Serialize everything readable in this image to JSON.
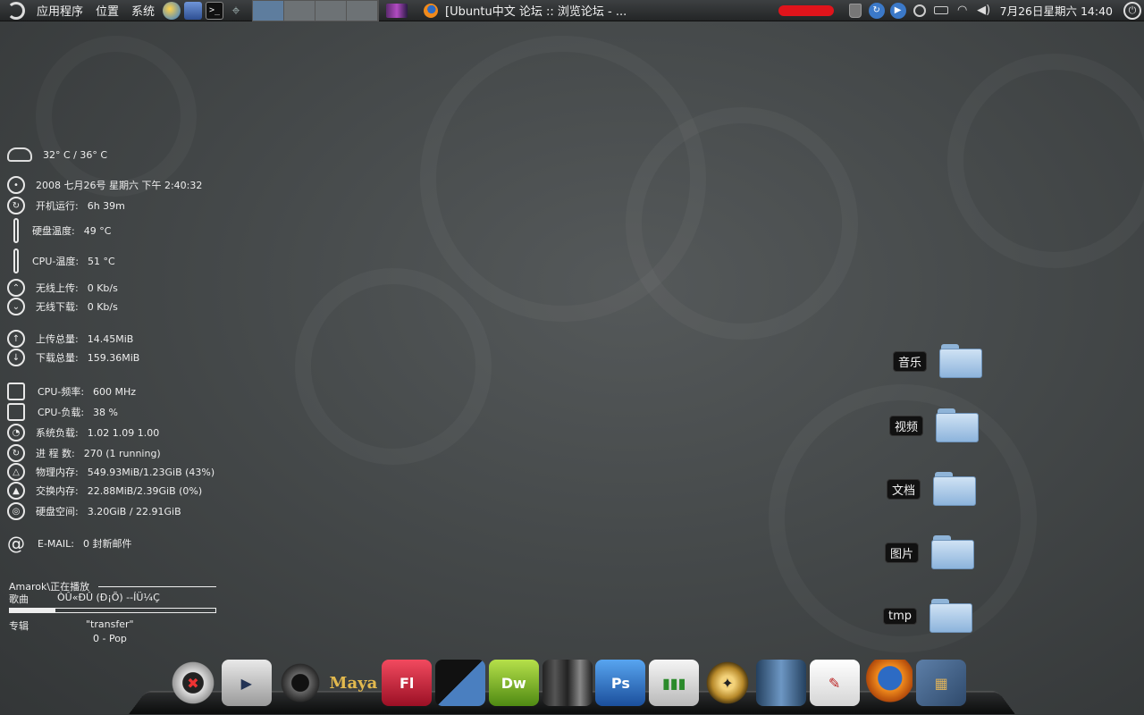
{
  "top_panel": {
    "menus": [
      "应用程序",
      "位置",
      "系统"
    ],
    "task_title": "[Ubuntu中文 论坛 :: 浏览论坛 - ...",
    "clock": "7月26日星期六 14:40",
    "launcher_icons": [
      "swirl-icon",
      "notes-icon",
      "terminal-icon",
      "crosshair-icon"
    ],
    "workspace_count": 4,
    "active_workspace": 1,
    "tray_icons": [
      "trash-icon",
      "network-share-icon",
      "play-icon",
      "search-icon",
      "keyboard-icon",
      "wifi-icon",
      "volume-icon"
    ]
  },
  "conky": {
    "weather": "32° C / 36° C",
    "datetime": "2008 七月26号 星期六 下午  2:40:32",
    "rows": [
      {
        "label": "开机运行:",
        "value": "6h 39m"
      },
      {
        "label": "硬盘温度:",
        "value": "49 °C"
      },
      {
        "label": "CPU-温度:",
        "value": "51 °C"
      },
      {
        "label": "无线上传:",
        "value": "0 Kb/s"
      },
      {
        "label": "无线下载:",
        "value": "0 Kb/s"
      },
      {
        "label": "上传总量:",
        "value": "14.45MiB"
      },
      {
        "label": "下载总量:",
        "value": "159.36MiB"
      },
      {
        "label": "CPU-频率:",
        "value": "600 MHz"
      },
      {
        "label": "CPU-负载:",
        "value": "38 %"
      },
      {
        "label": "系统负载:",
        "value": "1.02 1.09 1.00"
      },
      {
        "label": "进 程 数:",
        "value": "270 (1 running)"
      },
      {
        "label": "物理内存:",
        "value": "549.93MiB/1.23GiB (43%)"
      },
      {
        "label": "交换内存:",
        "value": "22.88MiB/2.39GiB (0%)"
      },
      {
        "label": "硬盘空间:",
        "value": "3.20GiB / 22.91GiB"
      },
      {
        "label": "E-MAIL:",
        "value": "0 封新邮件"
      }
    ],
    "amarok": {
      "header": "Amarok\\正在播放",
      "song_label": "歌曲",
      "song_value": "ÒÛ«ÐÛ (Ð¡Õ) --ÍÜ¼Ç",
      "progress": 0.22,
      "album_label": "专辑",
      "album_value": "\"transfer\"",
      "track_line": "0 - Pop"
    }
  },
  "desktop_items": [
    "音乐",
    "视频",
    "文档",
    "图片",
    "tmp"
  ],
  "dock": {
    "items": [
      {
        "name": "crossover-icon",
        "glyph": "✖"
      },
      {
        "name": "video-player-icon",
        "glyph": "▶"
      },
      {
        "name": "speaker-icon",
        "glyph": ""
      },
      {
        "name": "maya-icon",
        "glyph": "Maya"
      },
      {
        "name": "flash-icon",
        "glyph": "Fl"
      },
      {
        "name": "clapperboard-icon",
        "glyph": ""
      },
      {
        "name": "dreamweaver-icon",
        "glyph": "Dw"
      },
      {
        "name": "pens-icon",
        "glyph": ""
      },
      {
        "name": "photoshop-icon",
        "glyph": "Ps"
      },
      {
        "name": "chart-icon",
        "glyph": "▮▮▮"
      },
      {
        "name": "compass-icon",
        "glyph": "✦"
      },
      {
        "name": "bar-graph-icon",
        "glyph": ""
      },
      {
        "name": "notes-editor-icon",
        "glyph": "✎"
      },
      {
        "name": "firefox-icon",
        "glyph": ""
      },
      {
        "name": "package-icon",
        "glyph": "▦"
      }
    ]
  }
}
